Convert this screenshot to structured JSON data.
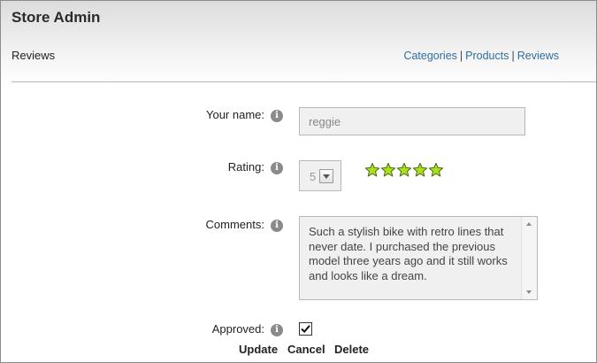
{
  "app": {
    "title": "Store Admin"
  },
  "header": {
    "page_title": "Reviews",
    "nav": [
      {
        "label": "Categories"
      },
      {
        "label": "Products"
      },
      {
        "label": "Reviews"
      }
    ],
    "nav_separator": "|"
  },
  "form": {
    "name": {
      "label": "Your name:",
      "value": "reggie"
    },
    "rating": {
      "label": "Rating:",
      "value": "5",
      "stars": 5,
      "star_color": "#a8e01c"
    },
    "comments": {
      "label": "Comments:",
      "value": "Such a stylish bike with retro lines that never date. I purchased the previous model three years ago and it still works and looks like a dream."
    },
    "approved": {
      "label": "Approved:",
      "checked": true
    },
    "info_icon": "info-icon",
    "info_glyph": "i"
  },
  "actions": {
    "update": "Update",
    "cancel": "Cancel",
    "delete": "Delete"
  },
  "colors": {
    "link": "#2f6e9e",
    "icon_gray": "#8a8a8a"
  }
}
